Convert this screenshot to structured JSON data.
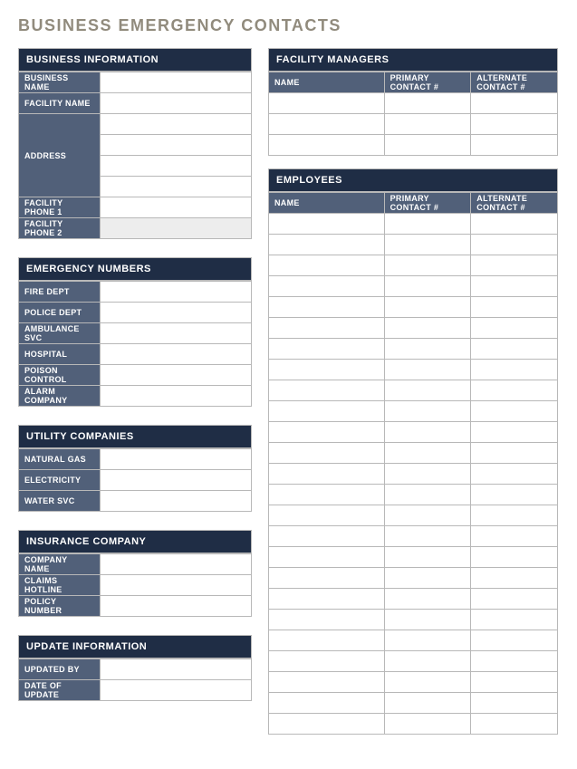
{
  "title": "BUSINESS EMERGENCY CONTACTS",
  "business_info": {
    "header": "BUSINESS INFORMATION",
    "rows": {
      "business_name": {
        "label": "BUSINESS NAME",
        "value": ""
      },
      "facility_name": {
        "label": "FACILITY NAME",
        "value": ""
      },
      "address": {
        "label": "ADDRESS",
        "values": [
          "",
          "",
          "",
          ""
        ]
      },
      "phone1": {
        "label": "FACILITY PHONE 1",
        "value": ""
      },
      "phone2": {
        "label": "FACILITY PHONE 2",
        "value": ""
      }
    }
  },
  "emergency": {
    "header": "EMERGENCY NUMBERS",
    "rows": [
      {
        "label": "FIRE DEPT",
        "value": ""
      },
      {
        "label": "POLICE DEPT",
        "value": ""
      },
      {
        "label": "AMBULANCE SVC",
        "value": ""
      },
      {
        "label": "HOSPITAL",
        "value": ""
      },
      {
        "label": "POISON CONTROL",
        "value": ""
      },
      {
        "label": "ALARM COMPANY",
        "value": ""
      }
    ]
  },
  "utility": {
    "header": "UTILITY COMPANIES",
    "rows": [
      {
        "label": "NATURAL GAS",
        "value": ""
      },
      {
        "label": "ELECTRICITY",
        "value": ""
      },
      {
        "label": "WATER SVC",
        "value": ""
      }
    ]
  },
  "insurance": {
    "header": "INSURANCE COMPANY",
    "rows": [
      {
        "label": "COMPANY NAME",
        "value": ""
      },
      {
        "label": "CLAIMS HOTLINE",
        "value": ""
      },
      {
        "label": "POLICY NUMBER",
        "value": ""
      }
    ]
  },
  "update": {
    "header": "UPDATE INFORMATION",
    "rows": [
      {
        "label": "UPDATED BY",
        "value": ""
      },
      {
        "label": "DATE OF UPDATE",
        "value": ""
      }
    ]
  },
  "facility_managers": {
    "header": "FACILITY MANAGERS",
    "columns": [
      "NAME",
      "PRIMARY CONTACT #",
      "ALTERNATE CONTACT #"
    ],
    "rows": [
      [
        "",
        "",
        ""
      ],
      [
        "",
        "",
        ""
      ],
      [
        "",
        "",
        ""
      ]
    ]
  },
  "employees": {
    "header": "EMPLOYEES",
    "columns": [
      "NAME",
      "PRIMARY CONTACT #",
      "ALTERNATE CONTACT #"
    ],
    "rows": [
      [
        "",
        "",
        ""
      ],
      [
        "",
        "",
        ""
      ],
      [
        "",
        "",
        ""
      ],
      [
        "",
        "",
        ""
      ],
      [
        "",
        "",
        ""
      ],
      [
        "",
        "",
        ""
      ],
      [
        "",
        "",
        ""
      ],
      [
        "",
        "",
        ""
      ],
      [
        "",
        "",
        ""
      ],
      [
        "",
        "",
        ""
      ],
      [
        "",
        "",
        ""
      ],
      [
        "",
        "",
        ""
      ],
      [
        "",
        "",
        ""
      ],
      [
        "",
        "",
        ""
      ],
      [
        "",
        "",
        ""
      ],
      [
        "",
        "",
        ""
      ],
      [
        "",
        "",
        ""
      ],
      [
        "",
        "",
        ""
      ],
      [
        "",
        "",
        ""
      ],
      [
        "",
        "",
        ""
      ],
      [
        "",
        "",
        ""
      ],
      [
        "",
        "",
        ""
      ],
      [
        "",
        "",
        ""
      ],
      [
        "",
        "",
        ""
      ],
      [
        "",
        "",
        ""
      ]
    ]
  }
}
